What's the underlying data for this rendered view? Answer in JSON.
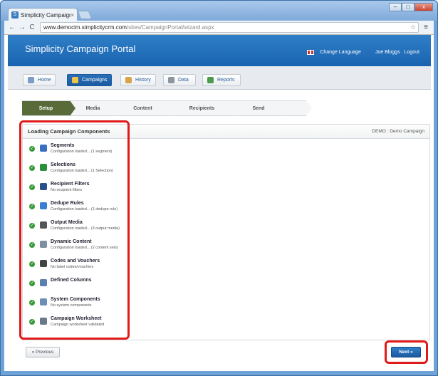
{
  "browser": {
    "tab_title": "Simplicity Campaign Port",
    "tab_close": "×",
    "favicon": "S",
    "url_host": "www.democim.simplicitycrm.com",
    "url_path": "/sites/CampaignPortal/wizard.aspx",
    "back": "←",
    "forward": "→",
    "reload": "C",
    "star": "☆",
    "menu": "≡",
    "controls": {
      "minimize": "–",
      "maximize": "□",
      "close": "x"
    }
  },
  "app": {
    "title": "Simplicity Campaign Portal",
    "change_language": "Change Language",
    "user": "Joe Bloggs",
    "logout": "Logout"
  },
  "nav": {
    "tabs": [
      {
        "label": "Home",
        "active": false,
        "icon": "home-icon"
      },
      {
        "label": "Campaigns",
        "active": true,
        "icon": "campaigns-icon"
      },
      {
        "label": "History",
        "active": false,
        "icon": "history-icon"
      },
      {
        "label": "Data",
        "active": false,
        "icon": "data-icon"
      },
      {
        "label": "Reports",
        "active": false,
        "icon": "reports-icon"
      }
    ]
  },
  "wizard": {
    "steps": [
      "Setup",
      "Media",
      "Content",
      "Recipients",
      "Send",
      ""
    ],
    "active_step": "Setup"
  },
  "panel": {
    "title": "Loading Campaign Components",
    "context": "DEMO : Demo Campaign",
    "items": [
      {
        "name": "Segments",
        "desc": "Configuration loaded... (1 segment)",
        "icon": "segments-icon",
        "color": "#3a6fc0"
      },
      {
        "name": "Selections",
        "desc": "Configuration loaded... (1 Selection)",
        "icon": "selections-icon",
        "color": "#2c8f3c"
      },
      {
        "name": "Recipient Filters",
        "desc": "No recipient filters",
        "icon": "filter-icon",
        "color": "#2a4f8a"
      },
      {
        "name": "Dedupe Rules",
        "desc": "Configuration loaded... (1 dedupe rule)",
        "icon": "dedupe-icon",
        "color": "#3a7fd0"
      },
      {
        "name": "Output Media",
        "desc": "Configuration loaded... (3 output media)",
        "icon": "output-media-icon",
        "color": "#555555"
      },
      {
        "name": "Dynamic Content",
        "desc": "Configuration loaded... (2 content sets)",
        "icon": "dynamic-content-icon",
        "color": "#7d8fa3"
      },
      {
        "name": "Codes and Vouchers",
        "desc": "No label codes/vouchers",
        "icon": "barcode-icon",
        "color": "#444444"
      },
      {
        "name": "Defined Columns",
        "desc": "",
        "icon": "columns-icon",
        "color": "#5b7fb0"
      },
      {
        "name": "System Components",
        "desc": "No system components",
        "icon": "system-components-icon",
        "color": "#6b8fb6"
      },
      {
        "name": "Campaign Worksheet",
        "desc": "Campaign worksheet validated",
        "icon": "worksheet-icon",
        "color": "#6a7a8a"
      }
    ],
    "check": "✓"
  },
  "buttons": {
    "previous": "« Previous",
    "next": "Next »"
  }
}
